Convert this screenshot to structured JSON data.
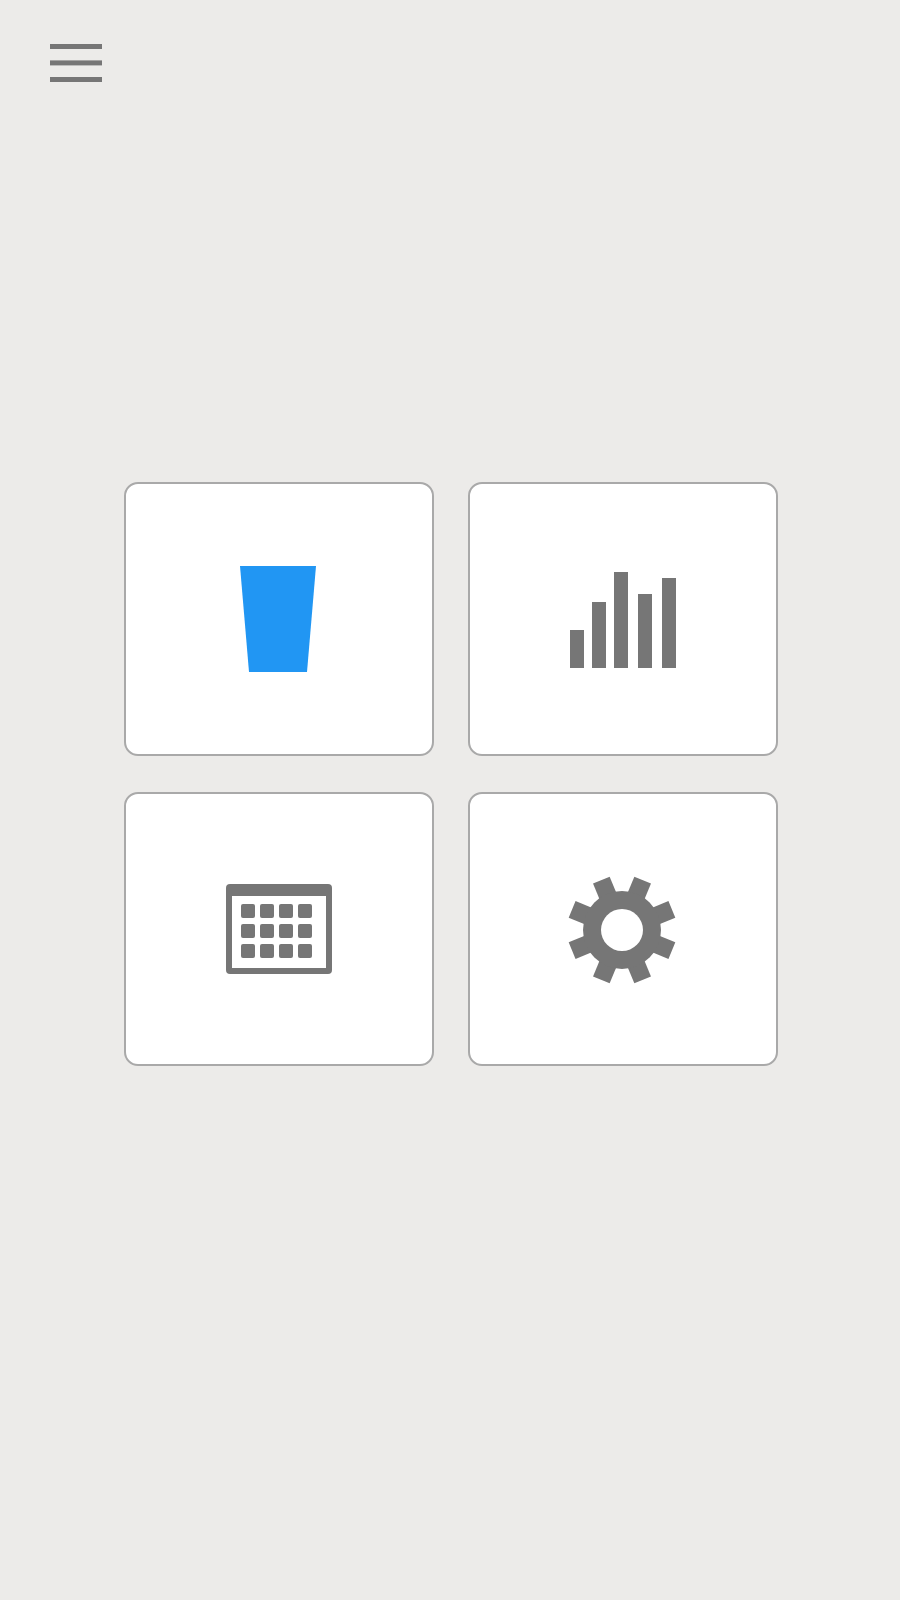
{
  "menu": {
    "kind": "hamburger"
  },
  "tiles": [
    {
      "kind": "cup"
    },
    {
      "kind": "bars"
    },
    {
      "kind": "calendar"
    },
    {
      "kind": "gear"
    }
  ]
}
